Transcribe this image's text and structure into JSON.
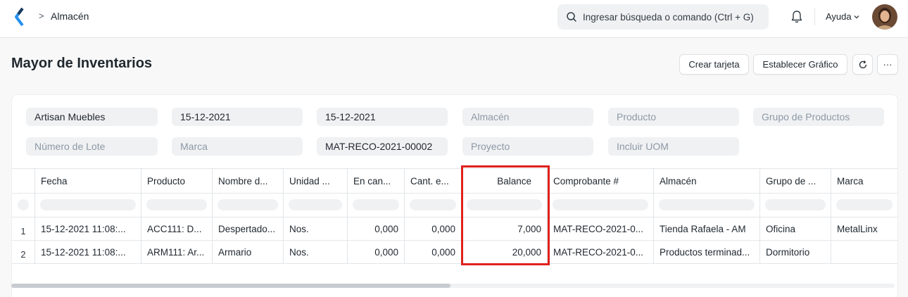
{
  "breadcrumb": {
    "separator": ">",
    "current": "Almacén"
  },
  "search": {
    "placeholder": "Ingresar búsqueda o comando (Ctrl + G)"
  },
  "help": {
    "label": "Ayuda"
  },
  "page": {
    "title": "Mayor de Inventarios"
  },
  "actions": {
    "create_card": "Crear tarjeta",
    "set_chart": "Establecer Gráfico",
    "more": "···"
  },
  "filters": {
    "company": "Artisan Muebles",
    "from_date": "15-12-2021",
    "to_date": "15-12-2021",
    "warehouse_placeholder": "Almacén",
    "item_placeholder": "Producto",
    "item_group_placeholder": "Grupo de Productos",
    "batch_placeholder": "Número de Lote",
    "brand_placeholder": "Marca",
    "voucher_no": "MAT-RECO-2021-00002",
    "project_placeholder": "Proyecto",
    "uom_placeholder": "Incluir UOM"
  },
  "table": {
    "columns": [
      "Fecha",
      "Producto",
      "Nombre d...",
      "Unidad ...",
      "En can...",
      "Cant. e...",
      "Balance",
      "Comprobante #",
      "Almacén",
      "Grupo de ...",
      "Marca"
    ],
    "rows": [
      {
        "index": "1",
        "cells": [
          "15-12-2021 11:08:...",
          "ACC111: D...",
          "Despertado...",
          "Nos.",
          "0,000",
          "0,000",
          "7,000",
          "MAT-RECO-2021-0...",
          "Tienda Rafaela - AM",
          "Oficina",
          "MetalLinx"
        ]
      },
      {
        "index": "2",
        "cells": [
          "15-12-2021 11:08:...",
          "ARM111: Ar...",
          "Armario",
          "Nos.",
          "0,000",
          "0,000",
          "20,000",
          "MAT-RECO-2021-0...",
          "Productos terminad...",
          "Dormitorio",
          ""
        ]
      }
    ]
  },
  "colors": {
    "highlight": "#e0211c",
    "brand": "#2490ef"
  }
}
